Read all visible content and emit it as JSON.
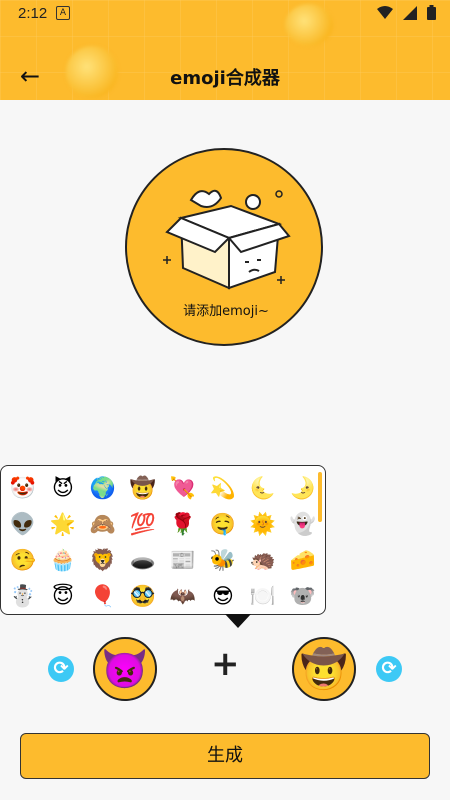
{
  "status": {
    "time": "2:12",
    "notif_letter": "A"
  },
  "header": {
    "title": "emoji合成器",
    "back_icon": "←"
  },
  "preview": {
    "hint": "请添加emoji~"
  },
  "emoji_picker": {
    "items": [
      "🤡",
      "😈",
      "🌍",
      "🤠",
      "💘",
      "💫",
      "🌜",
      "🌛",
      "👽",
      "🌟",
      "🙈",
      "💯",
      "🌹",
      "🤤",
      "🌞",
      "👻",
      "🤥",
      "🧁",
      "🦁",
      "🕳️",
      "📰",
      "🐝",
      "🦔",
      "🧀",
      "☃️",
      "😇",
      "🎈",
      "🥸",
      "🦇",
      "😎",
      "🍽️",
      "🐨"
    ]
  },
  "combiner": {
    "left_emoji": "👿",
    "right_emoji": "🤠",
    "plus_symbol": "+",
    "refresh_icon": "⟳"
  },
  "generate_label": "生成",
  "colors": {
    "accent": "#fdbb2d",
    "refresh": "#3dc9f5"
  }
}
